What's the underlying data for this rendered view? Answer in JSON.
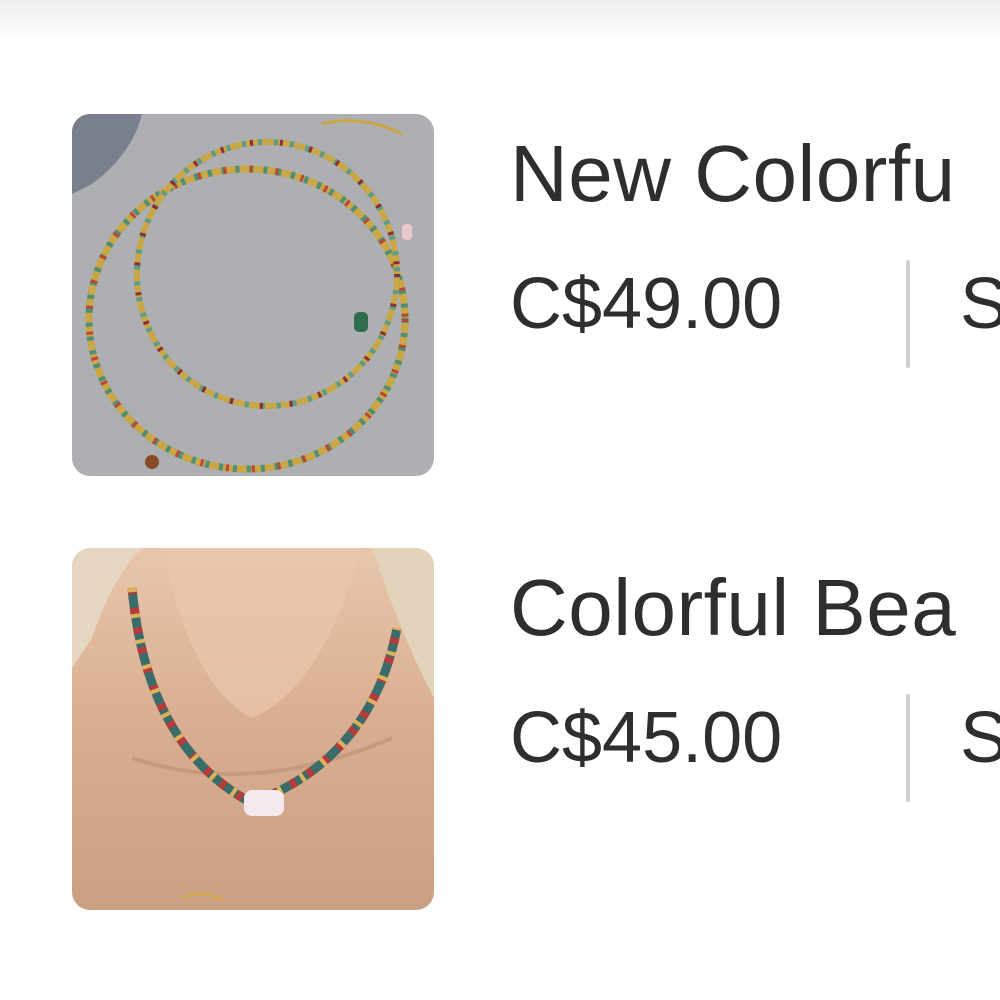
{
  "products": [
    {
      "image_icon": "layered-beaded-necklace-image",
      "title": "New Colorfu",
      "price": "C$49.00",
      "price_tail": "S"
    },
    {
      "image_icon": "beaded-pearl-necklace-on-model-image",
      "title": "Colorful Bea",
      "price": "C$45.00",
      "price_tail": "S"
    }
  ],
  "colors": {
    "text": "#2e2e2e",
    "divider": "#cfcfcf",
    "thumb1_bg": "#aeafb3",
    "thumb2_skin": "#dcb295"
  }
}
